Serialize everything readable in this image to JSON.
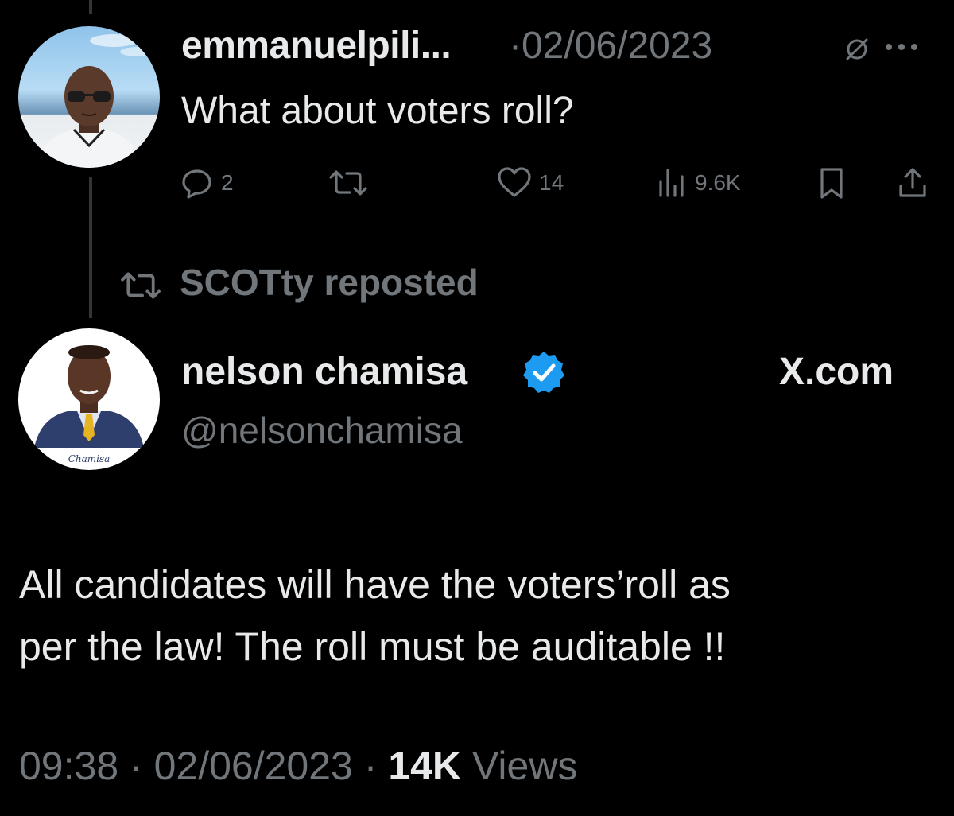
{
  "reply_tweet": {
    "display_name": "emmanuelpili...",
    "separator": "·",
    "date": "02/06/2023",
    "text": "What about voters roll?",
    "actions": {
      "reply_count": "2",
      "like_count": "14",
      "view_count": "9.6K"
    },
    "icons": [
      "grok-icon",
      "more-icon",
      "reply-icon",
      "retweet-icon",
      "like-icon",
      "views-icon",
      "bookmark-icon",
      "share-icon"
    ]
  },
  "repost_banner": {
    "text": "SCOTty reposted",
    "icon": "retweet-icon"
  },
  "main_tweet": {
    "display_name": "nelson chamisa",
    "handle": "@nelsonchamisa",
    "site": "X.com",
    "verified_color": "#1d9bf0",
    "text_lines": [
      "All candidates will have the voters’roll as",
      "per the law! The roll must be auditable !!"
    ],
    "time": "09:38",
    "separator": "·",
    "date": "02/06/2023",
    "views_count": "14K",
    "views_label": "Views"
  },
  "avatar2_signature": "Chamisa",
  "colors": {
    "background": "#000000",
    "text_primary": "#e7e9ea",
    "text_secondary": "#71767b",
    "thread_line": "#333639"
  }
}
